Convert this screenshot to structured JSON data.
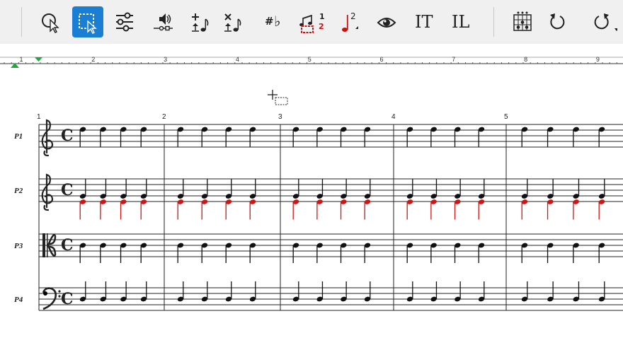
{
  "toolbar": {
    "tools": [
      {
        "name": "select-pointer-tool",
        "icon": "arrow-pointer-icon",
        "active": false
      },
      {
        "name": "region-select-tool",
        "icon": "region-select-icon",
        "active": true
      },
      {
        "name": "properties-tool",
        "icon": "sliders-icon",
        "active": false
      },
      {
        "name": "playback-tool",
        "icon": "speaker-icon",
        "active": false
      },
      {
        "name": "add-note-tool",
        "icon": "add-note-icon",
        "active": false
      },
      {
        "name": "delete-note-tool",
        "icon": "delete-note-icon",
        "active": false
      },
      {
        "name": "accidentals-tool",
        "icon": "sharp-flat-icon",
        "active": false
      },
      {
        "name": "voices-tool",
        "icon": "voices-icon",
        "active": false,
        "badge_top": "1",
        "badge_bottom": "2"
      },
      {
        "name": "second-voice-tool",
        "icon": "red-note-icon",
        "active": false,
        "badge": "2"
      },
      {
        "name": "view-tool",
        "icon": "eye-icon",
        "active": false
      },
      {
        "name": "text-tool",
        "icon": "text-cursor-icon",
        "active": false
      },
      {
        "name": "lyrics-tool",
        "icon": "lyrics-icon",
        "active": false
      },
      {
        "name": "chord-diagram-tool",
        "icon": "chord-grid-icon",
        "active": false
      },
      {
        "name": "undo-button",
        "icon": "undo-icon",
        "active": false
      },
      {
        "name": "redo-button",
        "icon": "redo-icon",
        "active": false
      }
    ],
    "text_tool_label": "IT",
    "lyrics_tool_label": "IL",
    "sharp_glyph": "#",
    "flat_glyph": "♭",
    "accent_color": "#1a7fd4",
    "voice_color": "#cc1010"
  },
  "ruler": {
    "numbers": [
      "1",
      "2",
      "3",
      "4",
      "5",
      "6",
      "7",
      "8",
      "9"
    ],
    "marker_color": "#21a83c"
  },
  "score": {
    "time_signature": "C",
    "measure_numbers": [
      "1",
      "2",
      "3",
      "4",
      "5"
    ],
    "staves": [
      {
        "label": "P1",
        "clef": "treble",
        "voices": 1
      },
      {
        "label": "P2",
        "clef": "treble",
        "voices": 2
      },
      {
        "label": "P3",
        "clef": "alto",
        "voices": 1
      },
      {
        "label": "P4",
        "clef": "bass",
        "voices": 1
      }
    ],
    "notes_per_measure": 4,
    "upper_voice_color": "#111111",
    "lower_voice_color": "#d41414"
  },
  "cursor": {
    "icon": "region-select-cursor-icon"
  }
}
